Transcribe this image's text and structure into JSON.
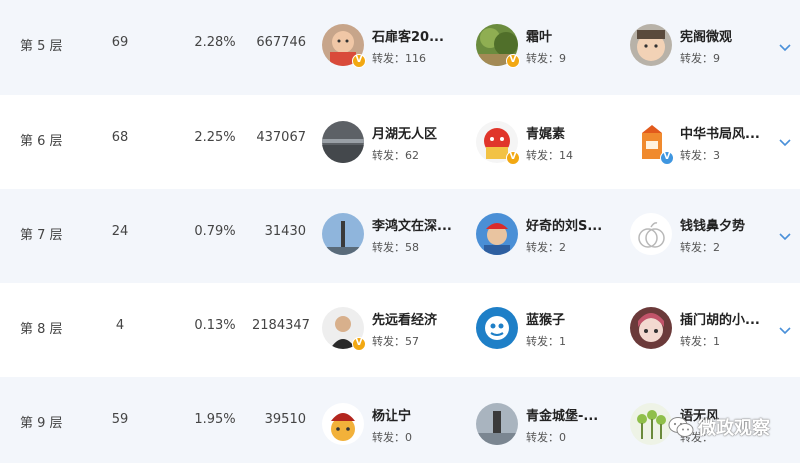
{
  "table": {
    "rows": [
      {
        "floor": "第 5 层",
        "count": "69",
        "percent": "2.28%",
        "reach": "667746",
        "users": [
          {
            "name": "石扉客20...",
            "reposts": "转发：116",
            "badge": "V"
          },
          {
            "name": "霜叶",
            "reposts": "转发：9",
            "badge": "V"
          },
          {
            "name": "宪阁微观",
            "reposts": "转发：9",
            "badge": ""
          }
        ]
      },
      {
        "floor": "第 6 层",
        "count": "68",
        "percent": "2.25%",
        "reach": "437067",
        "users": [
          {
            "name": "月湖无人区",
            "reposts": "转发：62",
            "badge": ""
          },
          {
            "name": "青娓素",
            "reposts": "转发：14",
            "badge": "V"
          },
          {
            "name": "中华书局风...",
            "reposts": "转发：3",
            "badge": "V"
          }
        ]
      },
      {
        "floor": "第 7 层",
        "count": "24",
        "percent": "0.79%",
        "reach": "31430",
        "users": [
          {
            "name": "李鸿文在深...",
            "reposts": "转发：58",
            "badge": ""
          },
          {
            "name": "好奇的刘S...",
            "reposts": "转发：2",
            "badge": ""
          },
          {
            "name": "钱钱鼻夕势",
            "reposts": "转发：2",
            "badge": ""
          }
        ]
      },
      {
        "floor": "第 8 层",
        "count": "4",
        "percent": "0.13%",
        "reach": "2184347",
        "users": [
          {
            "name": "先远看经济",
            "reposts": "转发：57",
            "badge": "V"
          },
          {
            "name": "蓝猴子",
            "reposts": "转发：1",
            "badge": ""
          },
          {
            "name": "插门胡的小...",
            "reposts": "转发：1",
            "badge": ""
          }
        ]
      },
      {
        "floor": "第 9 层",
        "count": "59",
        "percent": "1.95%",
        "reach": "39510",
        "users": [
          {
            "name": "杨让宁",
            "reposts": "转发：0",
            "badge": ""
          },
          {
            "name": "青金城堡-...",
            "reposts": "转发：0",
            "badge": ""
          },
          {
            "name": "语无风",
            "reposts": "转发：",
            "badge": ""
          }
        ]
      }
    ]
  },
  "watermark": {
    "text": "微政观察"
  },
  "icons": {
    "expand": "chevron-down-icon",
    "verified": "verified-badge-icon",
    "wechat": "wechat-logo-icon"
  },
  "colors": {
    "row_shade": "#f3f6fb",
    "chevron": "#4a90d9",
    "badge_gold": "#f2a812",
    "badge_blue": "#3f96e0"
  }
}
